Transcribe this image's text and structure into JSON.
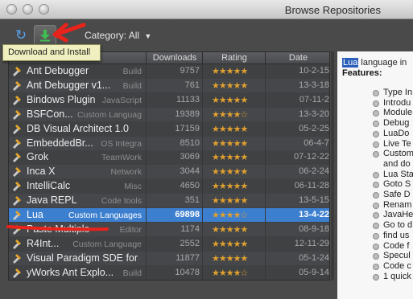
{
  "window": {
    "title": "Browse Repositories"
  },
  "toolbar": {
    "refresh_icon": "refresh-icon",
    "download_icon": "download-install-icon",
    "category_label": "Category: All",
    "tooltip": "Download and Install"
  },
  "table": {
    "columns": [
      "Downloads",
      "Rating",
      "Date"
    ],
    "rows": [
      {
        "name": "Ant Debugger",
        "category": "Build",
        "downloads": "9757",
        "stars": "★★★★★",
        "date": "10-2-15"
      },
      {
        "name": "Ant Debugger v1...",
        "category": "Build",
        "downloads": "761",
        "stars": "★★★★★",
        "date": "13-3-18"
      },
      {
        "name": "Bindows Plugin",
        "category": "JavaScript",
        "downloads": "11133",
        "stars": "★★★★★",
        "date": "07-11-2"
      },
      {
        "name": "BSFCon...",
        "category": "Custom Languag",
        "downloads": "19389",
        "stars": "★★★★☆",
        "date": "13-3-20"
      },
      {
        "name": "DB Visual Architect 1.0",
        "category": "",
        "downloads": "17159",
        "stars": "★★★★★",
        "date": "05-2-25"
      },
      {
        "name": "EmbeddedBr...",
        "category": "OS Integra",
        "downloads": "8510",
        "stars": "★★★★★",
        "date": "06-4-7"
      },
      {
        "name": "Grok",
        "category": "TeamWork",
        "downloads": "3069",
        "stars": "★★★★★",
        "date": "07-12-22"
      },
      {
        "name": "Inca X",
        "category": "Network",
        "downloads": "3044",
        "stars": "★★★★★",
        "date": "06-2-24"
      },
      {
        "name": "IntelliCalc",
        "category": "Misc",
        "downloads": "4650",
        "stars": "★★★★★",
        "date": "06-11-28"
      },
      {
        "name": "Java REPL",
        "category": "Code tools",
        "downloads": "351",
        "stars": "★★★★★",
        "date": "13-5-15"
      },
      {
        "name": "Lua",
        "category": "Custom Languages",
        "downloads": "69898",
        "stars": "★★★★☆",
        "date": "13-4-22"
      },
      {
        "name": "Paste Multiple",
        "category": "Editor",
        "downloads": "1174",
        "stars": "★★★★★",
        "date": "08-9-18"
      },
      {
        "name": "R4Int...",
        "category": "Custom Language",
        "downloads": "2552",
        "stars": "★★★★★",
        "date": "12-11-29"
      },
      {
        "name": "Visual Paradigm SDE for",
        "category": "",
        "downloads": "11877",
        "stars": "★★★★★",
        "date": "05-1-24"
      },
      {
        "name": "yWorks Ant Explo...",
        "category": "Build",
        "downloads": "10478",
        "stars": "★★★★☆",
        "date": "05-9-14"
      }
    ],
    "selected_index": 10
  },
  "description": {
    "head_hl": "Lua",
    "head_rest": " language in",
    "features_label": "Features:",
    "items": [
      "Type In",
      "Introdu",
      "Module",
      "Debug",
      "LuaDo",
      "Live Te",
      "Custom",
      "and do",
      "Lua Sta",
      "Goto S",
      "Safe D",
      "Renam",
      "JavaHe",
      "Go to d",
      "find us",
      "Code f",
      "Specul",
      "Code c",
      "1 quick"
    ]
  },
  "colors": {
    "accent": "#3d7fcf",
    "annotation": "#e8231c",
    "star": "#e0a030"
  }
}
